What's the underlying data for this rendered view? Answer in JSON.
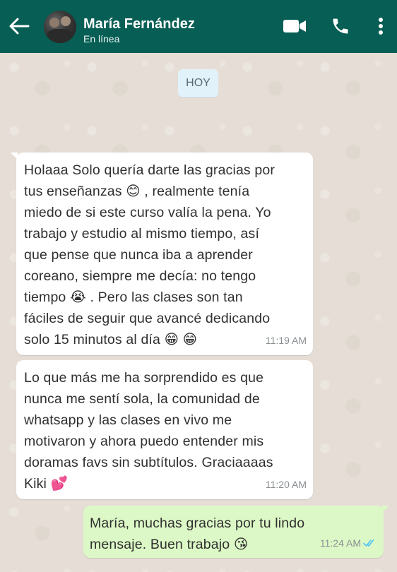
{
  "header": {
    "contact_name": "María Fernández",
    "status": "En línea",
    "background_color": "#075e54"
  },
  "icons": {
    "back": "arrow-left-icon",
    "video": "video-camera-icon",
    "phone": "phone-icon",
    "menu": "more-vertical-icon",
    "read_receipt": "double-check-icon"
  },
  "date_chip": "HOY",
  "messages": [
    {
      "direction": "incoming",
      "lines": [
        "Holaaa Solo quería darte las gracias por",
        "tus enseñanzas 😊 , realmente tenía",
        "miedo de si este curso valía la pena. Yo",
        "trabajo y estudio al mismo tiempo, así",
        "que pense que nunca iba a aprender",
        "coreano, siempre me decía: no tengo",
        "tiempo 😭 . Pero las clases son tan",
        "fáciles de seguir que avancé dedicando",
        "solo 15 minutos al día 😁 😁"
      ],
      "time": "11:19 AM"
    },
    {
      "direction": "incoming",
      "lines": [
        "Lo que más me ha sorprendido es que",
        "nunca me sentí sola, la comunidad de",
        "whatsapp y las clases en vivo me",
        "motivaron y ahora puedo entender mis",
        "doramas favs sin subtítulos. Graciaaaas",
        "Kiki 💕"
      ],
      "time": "11:20 AM"
    },
    {
      "direction": "outgoing",
      "lines": [
        "María, muchas gracias por tu lindo",
        "mensaje. Buen trabajo 😘"
      ],
      "time": "11:24 AM"
    }
  ],
  "colors": {
    "incoming_bubble": "#ffffff",
    "outgoing_bubble": "#dcf8c6",
    "read_receipt": "#4fc3f7"
  }
}
